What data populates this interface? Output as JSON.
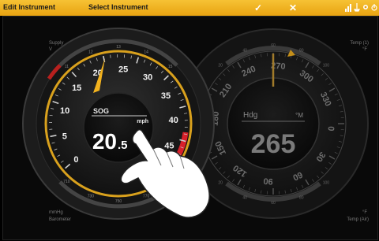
{
  "header": {
    "edit_label": "Edit Instrument",
    "select_label": "Select Instrument",
    "confirm_icon": "check-icon",
    "cancel_icon": "close-icon"
  },
  "colors": {
    "accent": "#f2b21e",
    "warning": "#d8202a"
  },
  "gauge_sog": {
    "label": "SOG",
    "unit": "mph",
    "value_int": "20",
    "value_dec": ".5",
    "ticks": [
      "0",
      "5",
      "10",
      "15",
      "20",
      "25",
      "30",
      "35",
      "40",
      "45"
    ],
    "top_left": "Supply",
    "top_left_unit": "V",
    "bottom_left": "mmHg",
    "bottom_left_name": "Barometer",
    "inner_scale": [
      "11",
      "12",
      "13",
      "14",
      "15"
    ],
    "outer_scale": [
      "710",
      "730",
      "750",
      "770",
      "790"
    ]
  },
  "gauge_hdg": {
    "label": "Hdg",
    "unit": "°M",
    "value": "265",
    "ticks": [
      "0",
      "30",
      "60",
      "90",
      "120",
      "150",
      "180",
      "210",
      "240",
      "270",
      "300",
      "330"
    ],
    "top_right": "Temp (1)",
    "top_right_unit": "°F",
    "bottom_right_unit": "°F",
    "bottom_right": "Temp (Air)",
    "top_scale": [
      "20",
      "40",
      "60",
      "80",
      "100"
    ],
    "bottom_scale": [
      "20",
      "40",
      "60",
      "80",
      "100"
    ]
  }
}
